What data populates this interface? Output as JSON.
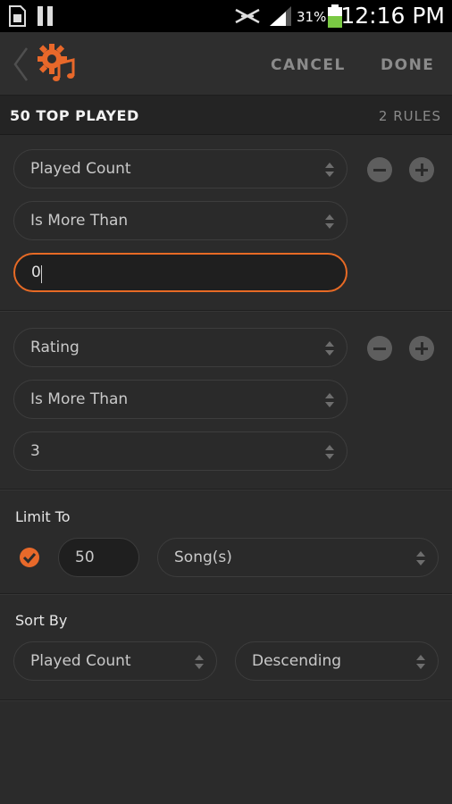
{
  "status_bar": {
    "time": "12:16 PM",
    "battery_percent": "31%",
    "icons": [
      "sim-card-icon",
      "pause-icon",
      "no-signal-icon",
      "signal-bars-icon",
      "battery-icon"
    ]
  },
  "action_bar": {
    "back_icon": "chevron-left-icon",
    "app_icon": "gear-music-icon",
    "cancel_label": "CANCEL",
    "done_label": "DONE"
  },
  "header": {
    "title": "50 TOP PLAYED",
    "rules_count": "2 RULES"
  },
  "rules": [
    {
      "field": "Played Count",
      "operator": "Is More Than",
      "value": "0",
      "value_focused": true
    },
    {
      "field": "Rating",
      "operator": "Is More Than",
      "value": "3",
      "value_focused": false
    }
  ],
  "limit": {
    "label": "Limit To",
    "checked": true,
    "count": "50",
    "unit": "Song(s)"
  },
  "sort": {
    "label": "Sort By",
    "field": "Played Count",
    "order": "Descending"
  },
  "colors": {
    "accent": "#e76a25",
    "background": "#2b2b2b"
  }
}
